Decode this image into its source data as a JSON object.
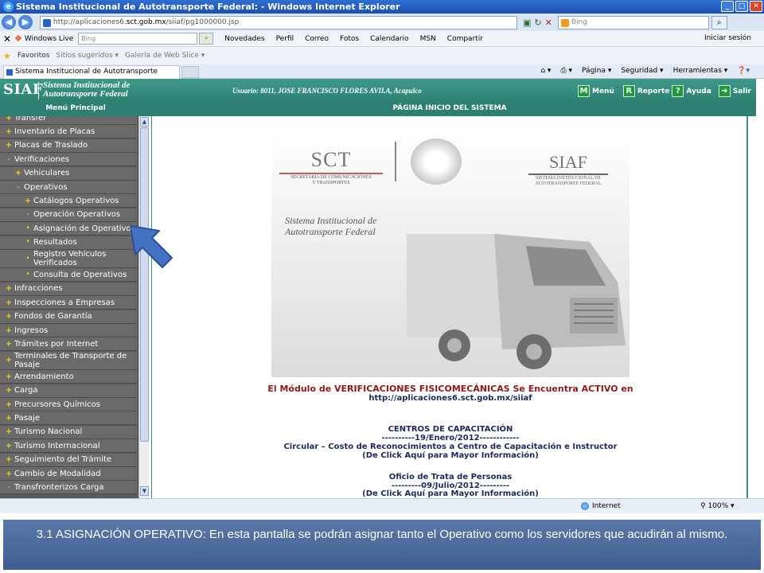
{
  "window": {
    "title": "Sistema Institucional de Autotransporte Federal: - Windows Internet Explorer"
  },
  "address": {
    "url_prefix": "http://aplicaciones6.",
    "url_domain": "sct.gob.mx",
    "url_suffix": "/siiaf/pg1000000.jsp",
    "search_placeholder": "Bing"
  },
  "livebar": {
    "brand": "Windows Live",
    "search_placeholder": "Bing",
    "items": [
      "Novedades",
      "Perfil",
      "Correo",
      "Fotos",
      "Calendario",
      "MSN",
      "Compartir"
    ],
    "signin": "Iniciar sesión"
  },
  "favbar": {
    "favorites": "Favoritos",
    "links": [
      "Sitios sugeridos ▾",
      "Galería de Web Slice ▾"
    ]
  },
  "tabs": {
    "active": "Sistema Institucional de Autotransporte Federal:",
    "commands": [
      "Página ▾",
      "Seguridad ▾",
      "Herramientas ▾"
    ]
  },
  "siaf": {
    "logo": "SIAF",
    "subtitle_line1": "Sistema Institucional de",
    "subtitle_line2": "Autotransporte Federal",
    "user": "Usuario: 8011, JOSE FRANCISCO FLORES AVILA, Acapulco",
    "buttons": [
      {
        "icon": "M",
        "label": "Menú"
      },
      {
        "icon": "R",
        "label": "Reporte"
      },
      {
        "icon": "?",
        "label": "Ayuda"
      },
      {
        "icon": "➜",
        "label": "Salir"
      }
    ]
  },
  "section": {
    "menu_title": "Menú Principal",
    "page_title": "PÁGINA INICIO DEL SISTEMA"
  },
  "sidebar": {
    "items": [
      {
        "mark": "+",
        "label": "Transfer",
        "level": 0
      },
      {
        "mark": "+",
        "label": "Inventario de Placas",
        "level": 0
      },
      {
        "mark": "+",
        "label": "Placas de Traslado",
        "level": 0
      },
      {
        "mark": "-",
        "label": "Verificaciones",
        "level": 0
      },
      {
        "mark": "+",
        "label": "Vehiculares",
        "level": 1
      },
      {
        "mark": "-",
        "label": "Operativos",
        "level": 1
      },
      {
        "mark": "+",
        "label": "Catálogos Operativos",
        "level": 2
      },
      {
        "mark": "-",
        "label": "Operación Operativos",
        "level": 2
      },
      {
        "mark": "•",
        "label": "Asignación de Operativo",
        "level": 2
      },
      {
        "mark": "•",
        "label": "Resultados",
        "level": 2
      },
      {
        "mark": "•",
        "label": "Registro Vehículos Verificados",
        "level": 2
      },
      {
        "mark": "•",
        "label": "Consulta de Operativos",
        "level": 2
      },
      {
        "mark": "+",
        "label": "Infracciones",
        "level": 0
      },
      {
        "mark": "+",
        "label": "Inspecciones a Empresas",
        "level": 0
      },
      {
        "mark": "+",
        "label": "Fondos de Garantía",
        "level": 0
      },
      {
        "mark": "+",
        "label": "Ingresos",
        "level": 0
      },
      {
        "mark": "+",
        "label": "Trámites por Internet",
        "level": 0
      },
      {
        "mark": "+",
        "label": "Terminales de Transporte de Pasaje",
        "level": 0
      },
      {
        "mark": "+",
        "label": "Arrendamiento",
        "level": 0
      },
      {
        "mark": "+",
        "label": "Carga",
        "level": 0
      },
      {
        "mark": "+",
        "label": "Precursores Químicos",
        "level": 0
      },
      {
        "mark": "+",
        "label": "Pasaje",
        "level": 0
      },
      {
        "mark": "+",
        "label": "Turismo Nacional",
        "level": 0
      },
      {
        "mark": "+",
        "label": "Turismo Internacional",
        "level": 0
      },
      {
        "mark": "+",
        "label": "Seguimiento del Trámite",
        "level": 0
      },
      {
        "mark": "+",
        "label": "Cambio de Modalidad",
        "level": 0
      },
      {
        "mark": "-",
        "label": "Transfronterizos Carga",
        "level": 0
      }
    ]
  },
  "content": {
    "sct_big": "SCT",
    "sct_small_1": "SECRETARÍA DE COMUNICACIONES",
    "sct_small_2": "Y TRANSPORTES",
    "siaf_big": "SIAF",
    "siaf_small_1": "SISTEMA INSTITUCIONAL DE",
    "siaf_small_2": "AUTOTRANSPORTE FEDERAL",
    "sist_line1": "Sistema Institucional de",
    "sist_line2": "Autotransporte Federal",
    "modulo": "El Módulo de VERIFICACIONES FISICOMECÁNICAS Se Encuentra ACTIVO en",
    "modulo_url": "http://aplicaciones6.sct.gob.mx/siiaf",
    "cap_title": "CENTROS DE CAPACITACIÓN",
    "cap_date": "----------19/Enero/2012------------",
    "cap_circ": "Circular – Costo de Reconocimientos a Centro de Capacitación e Instructor",
    "cap_click": "(De Click Aquí para Mayor Información)",
    "trata_title": "Oficio de Trata de Personas",
    "trata_date": "---------09/Julio/2012---------",
    "trata_click": "(De Click Aquí para Mayor Información)"
  },
  "status": {
    "zone": "Internet",
    "zoom": "100%"
  },
  "caption": "3.1 ASIGNACIÓN OPERATIVO: En esta pantalla se podrán asignar tanto el Operativo como los servidores que acudirán al mismo.",
  "colors": {
    "header_green": "#2c7f71",
    "sidebar_gray": "#6a6a6a",
    "arrow_blue": "#4472c4",
    "caption_blue": "#4a68a0"
  }
}
